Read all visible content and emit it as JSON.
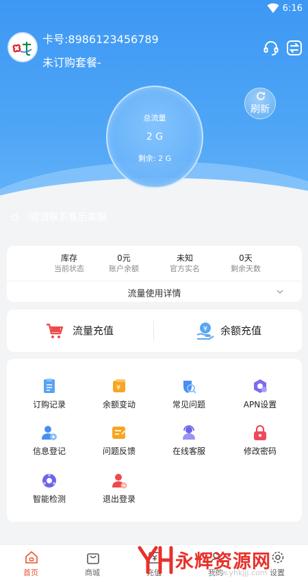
{
  "status_bar": {
    "time": "6:16",
    "wifi_icon": "wifi-icon"
  },
  "header": {
    "card_number": "卡号:8986123456789",
    "package": "未订购套餐-",
    "icons": [
      "support-headset-icon",
      "switch-card-icon"
    ]
  },
  "traffic": {
    "label": "总流量",
    "value": "2 G",
    "remaining": "剩余: 2 G",
    "progress_fraction": 1.0
  },
  "refresh_label": "刷新",
  "notice": "l题请联系售后客服",
  "stats": [
    {
      "value": "库存",
      "label": "当前状态"
    },
    {
      "value": "0元",
      "label": "账户余额"
    },
    {
      "value": "未知",
      "label": "官方实名"
    },
    {
      "value": "0天",
      "label": "剩余天数"
    }
  ],
  "usage_detail": "流量使用详情",
  "recharge": [
    {
      "label": "流量充值",
      "icon": "cart-icon"
    },
    {
      "label": "余额充值",
      "icon": "wallet-icon"
    }
  ],
  "menu": [
    {
      "label": "订购记录",
      "icon": "order-record-icon"
    },
    {
      "label": "余额变动",
      "icon": "balance-change-icon"
    },
    {
      "label": "常见问题",
      "icon": "faq-icon"
    },
    {
      "label": "APN设置",
      "icon": "apn-settings-icon"
    },
    {
      "label": "信息登记",
      "icon": "user-register-icon"
    },
    {
      "label": "问题反馈",
      "icon": "feedback-icon"
    },
    {
      "label": "在线客服",
      "icon": "online-service-icon"
    },
    {
      "label": "修改密码",
      "icon": "lock-icon"
    },
    {
      "label": "智能检测",
      "icon": "smart-detect-icon"
    },
    {
      "label": "退出登录",
      "icon": "logout-icon"
    }
  ],
  "tabs": [
    {
      "label": "首页",
      "icon": "home-icon",
      "active": true
    },
    {
      "label": "商城",
      "icon": "shop-bag-icon",
      "active": false
    },
    {
      "label": "充值",
      "icon": "recharge-icon",
      "active": false
    },
    {
      "label": "我的",
      "icon": "profile-icon",
      "active": false
    },
    {
      "label": "设置",
      "icon": "settings-icon",
      "active": false
    }
  ],
  "watermark": {
    "text": "永辉资源网",
    "url": "www.yhkjjj.com"
  },
  "colors": {
    "primary_blue": "#3d98f4",
    "accent_red": "#e8542f",
    "menu_blue": "#4a8ff0",
    "menu_orange": "#f5a623"
  }
}
